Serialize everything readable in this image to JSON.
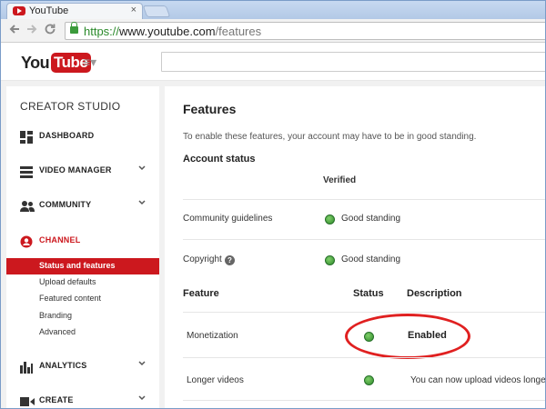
{
  "browser": {
    "tab_title": "YouTube",
    "tab_close": "×",
    "url_scheme": "https://",
    "url_host": "www.youtube.com",
    "url_path": "/features",
    "back_icon": "arrow-left",
    "forward_icon": "arrow-right",
    "reload_icon": "reload"
  },
  "header": {
    "logo_you": "You",
    "logo_tube": "Tube",
    "guide_icon": "≡▾",
    "brand_color": "#cc181e"
  },
  "sidebar": {
    "title": "CREATOR STUDIO",
    "items": [
      {
        "label": "DASHBOARD",
        "icon": "dashboard-icon",
        "chevron": ""
      },
      {
        "label": "VIDEO MANAGER",
        "icon": "video-manager-icon",
        "chevron": "⌄"
      },
      {
        "label": "COMMUNITY",
        "icon": "community-icon",
        "chevron": "⌄"
      },
      {
        "label": "CHANNEL",
        "icon": "channel-icon",
        "chevron": ""
      },
      {
        "label": "ANALYTICS",
        "icon": "analytics-icon",
        "chevron": "⌄"
      },
      {
        "label": "CREATE",
        "icon": "create-icon",
        "chevron": "⌄"
      }
    ],
    "channel_sub": [
      {
        "label": "Status and features",
        "active": true
      },
      {
        "label": "Upload defaults"
      },
      {
        "label": "Featured content"
      },
      {
        "label": "Branding"
      },
      {
        "label": "Advanced"
      }
    ]
  },
  "main": {
    "title": "Features",
    "intro": "To enable these features, your account may have to be in good standing.",
    "account_status": {
      "heading": "Account status",
      "verified": "Verified",
      "rows": [
        {
          "label": "Community guidelines",
          "status": "Good standing"
        },
        {
          "label": "Copyright",
          "status": "Good standing",
          "help": "?"
        }
      ]
    },
    "features_table": {
      "headers": [
        "Feature",
        "Status",
        "Description"
      ],
      "rows": [
        {
          "feature": "Monetization",
          "description": "Enabled"
        },
        {
          "feature": "Longer videos",
          "description": "You can now upload videos longe"
        }
      ]
    },
    "status_color": "#3c9b3c",
    "highlight_color": "#e02020"
  }
}
